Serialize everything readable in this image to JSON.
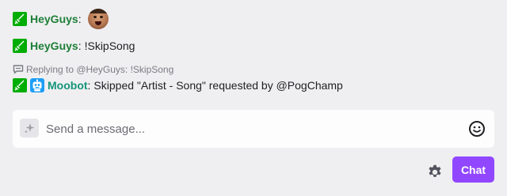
{
  "messages": [
    {
      "user": "HeyGuys",
      "separator": ":",
      "text": "",
      "emote": "face-emote"
    },
    {
      "user": "HeyGuys",
      "separator": ":",
      "text": "!SkipSong"
    },
    {
      "reply_to": "Replying to @HeyGuys: !SkipSong",
      "user": "Moobot",
      "separator": ":",
      "text": "Skipped \"Artist - Song\" requested by @PogChamp"
    }
  ],
  "input": {
    "placeholder": "Send a message...",
    "value": ""
  },
  "buttons": {
    "chat_label": "Chat"
  },
  "icons": {
    "moderator_badge": "sword-icon",
    "bot_badge": "robot-icon",
    "reply": "reply-bubble-icon",
    "sparkle": "sparkle-icon",
    "emoji": "smiley-icon",
    "settings": "gear-icon"
  },
  "colors": {
    "background": "#efeff1",
    "username_heyguys": "#1e7f37",
    "username_moobot": "#14957a",
    "mod_badge": "#00ad03",
    "bot_badge": "#1c9ef7",
    "accent": "#9147ff"
  }
}
